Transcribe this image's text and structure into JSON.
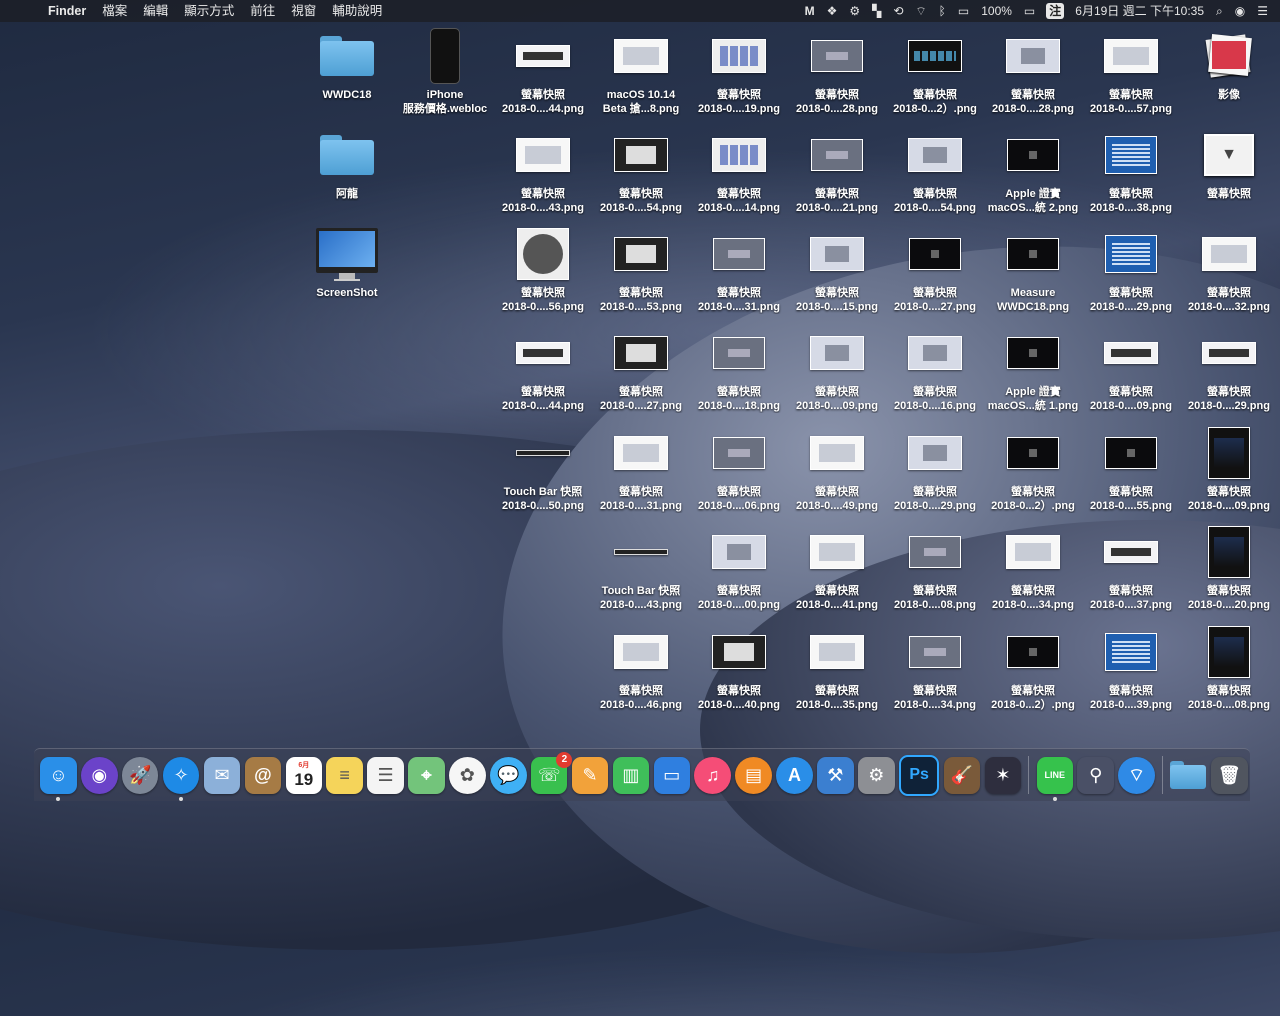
{
  "menubar": {
    "app": "Finder",
    "menus": [
      "檔案",
      "編輯",
      "顯示方式",
      "前往",
      "視窗",
      "輔助說明"
    ],
    "battery": "100%",
    "input_method": "注",
    "clock": "6月19日 週二 下午10:35"
  },
  "desktop": {
    "icons": [
      {
        "label": [
          "WWDC18",
          ""
        ],
        "kind": "folder"
      },
      {
        "label": [
          "iPhone",
          "服務價格.webloc"
        ],
        "kind": "phone"
      },
      {
        "label": [
          "螢幕快照",
          "2018-0....44.png"
        ],
        "kind": "bar"
      },
      {
        "label": [
          "macOS 10.14",
          "Beta 搶...8.png"
        ],
        "kind": "light"
      },
      {
        "label": [
          "螢幕快照",
          "2018-0....19.png"
        ],
        "kind": "grid"
      },
      {
        "label": [
          "螢幕快照",
          "2018-0....28.png"
        ],
        "kind": "gray"
      },
      {
        "label": [
          "螢幕快照",
          "2018-0...2）.png"
        ],
        "kind": "darkgrid"
      },
      {
        "label": [
          "螢幕快照",
          "2018-0....28.png"
        ],
        "kind": "dialog"
      },
      {
        "label": [
          "螢幕快照",
          "2018-0....57.png"
        ],
        "kind": "light"
      },
      {
        "label": [
          "影像",
          ""
        ],
        "kind": "stack"
      },
      {
        "label": [
          "阿龍",
          ""
        ],
        "kind": "folder"
      },
      {
        "label": [
          "螢幕快照",
          "2018-0....43.png"
        ],
        "kind": "light"
      },
      {
        "label": [
          "螢幕快照",
          "2018-0....54.png"
        ],
        "kind": "dark"
      },
      {
        "label": [
          "螢幕快照",
          "2018-0....14.png"
        ],
        "kind": "grid"
      },
      {
        "label": [
          "螢幕快照",
          "2018-0....21.png"
        ],
        "kind": "gray"
      },
      {
        "label": [
          "螢幕快照",
          "2018-0....54.png"
        ],
        "kind": "dialog"
      },
      {
        "label": [
          "Apple 證實",
          "macOS...統 2.png"
        ],
        "kind": "black"
      },
      {
        "label": [
          "螢幕快照",
          "2018-0....38.png"
        ],
        "kind": "blue"
      },
      {
        "label": [
          "螢幕快照",
          ""
        ],
        "kind": "download"
      },
      {
        "label": [
          "ScreenShot",
          ""
        ],
        "kind": "imac"
      },
      {
        "label": [
          "螢幕快照",
          "2018-0....56.png"
        ],
        "kind": "photo"
      },
      {
        "label": [
          "螢幕快照",
          "2018-0....53.png"
        ],
        "kind": "dark"
      },
      {
        "label": [
          "螢幕快照",
          "2018-0....31.png"
        ],
        "kind": "gray"
      },
      {
        "label": [
          "螢幕快照",
          "2018-0....15.png"
        ],
        "kind": "dialog"
      },
      {
        "label": [
          "螢幕快照",
          "2018-0....27.png"
        ],
        "kind": "black"
      },
      {
        "label": [
          "Measure",
          "WWDC18.png"
        ],
        "kind": "black"
      },
      {
        "label": [
          "螢幕快照",
          "2018-0....29.png"
        ],
        "kind": "blue"
      },
      {
        "label": [
          "螢幕快照",
          "2018-0....32.png"
        ],
        "kind": "light"
      },
      {
        "label": [
          "螢幕快照",
          "2018-0....44.png"
        ],
        "kind": "bar"
      },
      {
        "label": [
          "螢幕快照",
          "2018-0....27.png"
        ],
        "kind": "dark"
      },
      {
        "label": [
          "螢幕快照",
          "2018-0....18.png"
        ],
        "kind": "gray"
      },
      {
        "label": [
          "螢幕快照",
          "2018-0....09.png"
        ],
        "kind": "dialog"
      },
      {
        "label": [
          "螢幕快照",
          "2018-0....16.png"
        ],
        "kind": "dialog"
      },
      {
        "label": [
          "Apple 證實",
          "macOS...統 1.png"
        ],
        "kind": "black"
      },
      {
        "label": [
          "螢幕快照",
          "2018-0....09.png"
        ],
        "kind": "bar"
      },
      {
        "label": [
          "螢幕快照",
          "2018-0....29.png"
        ],
        "kind": "bar"
      },
      {
        "label": [
          "Touch Bar 快照",
          "2018-0....50.png"
        ],
        "kind": "strip"
      },
      {
        "label": [
          "螢幕快照",
          "2018-0....31.png"
        ],
        "kind": "light"
      },
      {
        "label": [
          "螢幕快照",
          "2018-0....06.png"
        ],
        "kind": "gray"
      },
      {
        "label": [
          "螢幕快照",
          "2018-0....49.png"
        ],
        "kind": "light"
      },
      {
        "label": [
          "螢幕快照",
          "2018-0....29.png"
        ],
        "kind": "dialog"
      },
      {
        "label": [
          "螢幕快照",
          "2018-0...2）.png"
        ],
        "kind": "black"
      },
      {
        "label": [
          "螢幕快照",
          "2018-0....55.png"
        ],
        "kind": "black"
      },
      {
        "label": [
          "螢幕快照",
          "2018-0....09.png"
        ],
        "kind": "tall"
      },
      {
        "label": [
          "Touch Bar 快照",
          "2018-0....43.png"
        ],
        "kind": "strip"
      },
      {
        "label": [
          "螢幕快照",
          "2018-0....00.png"
        ],
        "kind": "dialog"
      },
      {
        "label": [
          "螢幕快照",
          "2018-0....41.png"
        ],
        "kind": "light"
      },
      {
        "label": [
          "螢幕快照",
          "2018-0....08.png"
        ],
        "kind": "gray"
      },
      {
        "label": [
          "螢幕快照",
          "2018-0....34.png"
        ],
        "kind": "light"
      },
      {
        "label": [
          "螢幕快照",
          "2018-0....37.png"
        ],
        "kind": "bar"
      },
      {
        "label": [
          "螢幕快照",
          "2018-0....20.png"
        ],
        "kind": "tall"
      },
      {
        "label": [
          "螢幕快照",
          "2018-0....46.png"
        ],
        "kind": "light"
      },
      {
        "label": [
          "螢幕快照",
          "2018-0....40.png"
        ],
        "kind": "dark"
      },
      {
        "label": [
          "螢幕快照",
          "2018-0....35.png"
        ],
        "kind": "light"
      },
      {
        "label": [
          "螢幕快照",
          "2018-0....34.png"
        ],
        "kind": "gray"
      },
      {
        "label": [
          "螢幕快照",
          "2018-0...2）.png"
        ],
        "kind": "black"
      },
      {
        "label": [
          "螢幕快照",
          "2018-0....39.png"
        ],
        "kind": "blue"
      },
      {
        "label": [
          "螢幕快照",
          "2018-0....08.png"
        ],
        "kind": "tall"
      }
    ]
  },
  "dock": {
    "messages_badge": "2",
    "calendar_month": "6月",
    "calendar_day": "19",
    "photoshop_label": "Ps",
    "line_label": "LINE",
    "apps": [
      {
        "name": "finder-dock-icon",
        "color": "#2a8fe8",
        "glyph": "☺",
        "dot": true
      },
      {
        "name": "siri-dock-icon",
        "color": "#6b43c9",
        "glyph": "◉",
        "dot": false
      },
      {
        "name": "launchpad-dock-icon",
        "color": "#7d8797",
        "glyph": "🚀",
        "dot": false
      },
      {
        "name": "safari-dock-icon",
        "color": "#1e8ae6",
        "glyph": "✧",
        "dot": true
      },
      {
        "name": "mail-preview-dock-icon",
        "color": "#8cb0d9",
        "glyph": "✉",
        "dot": false
      },
      {
        "name": "contacts-dock-icon",
        "color": "#a67b45",
        "glyph": "@",
        "dot": false
      },
      {
        "name": "calendar-dock-icon",
        "color": "#ffffff",
        "glyph": "",
        "dot": false
      },
      {
        "name": "notes-dock-icon",
        "color": "#f5d45a",
        "glyph": "≡",
        "dot": false
      },
      {
        "name": "reminders-dock-icon",
        "color": "#f4f4f4",
        "glyph": "☰",
        "dot": false
      },
      {
        "name": "maps-dock-icon",
        "color": "#73c47b",
        "glyph": "⌖",
        "dot": false
      },
      {
        "name": "photos-dock-icon",
        "color": "#f6f6f6",
        "glyph": "✿",
        "dot": false
      },
      {
        "name": "messages-dock-icon",
        "color": "#3fb0f5",
        "glyph": "💬",
        "dot": false
      },
      {
        "name": "facetime-dock-icon",
        "color": "#39c04e",
        "glyph": "☏",
        "dot": false
      },
      {
        "name": "pages-dock-icon",
        "color": "#f2a23a",
        "glyph": "✎",
        "dot": false
      },
      {
        "name": "numbers-dock-icon",
        "color": "#3fbf5a",
        "glyph": "▥",
        "dot": false
      },
      {
        "name": "keynote-dock-icon",
        "color": "#2f7fe0",
        "glyph": "▭",
        "dot": false
      },
      {
        "name": "itunes-dock-icon",
        "color": "#f54d77",
        "glyph": "♫",
        "dot": false
      },
      {
        "name": "ibooks-dock-icon",
        "color": "#f08a24",
        "glyph": "▤",
        "dot": false
      },
      {
        "name": "app-store-dock-icon",
        "color": "#2a8ee8",
        "glyph": "A",
        "dot": false
      },
      {
        "name": "xcode-dock-icon",
        "color": "#3b7fd0",
        "glyph": "⚒",
        "dot": false
      },
      {
        "name": "system-preferences-dock-icon",
        "color": "#8d8f94",
        "glyph": "⚙",
        "dot": false
      },
      {
        "name": "photoshop-dock-icon",
        "color": "#0f2238",
        "glyph": "",
        "dot": false
      },
      {
        "name": "instruments-dock-icon",
        "color": "#7a5a3a",
        "glyph": "🎸",
        "dot": false
      },
      {
        "name": "final-cut-dock-icon",
        "color": "#2e2e3e",
        "glyph": "✶",
        "dot": false
      },
      {
        "name": "sep",
        "color": "",
        "glyph": "",
        "dot": false
      },
      {
        "name": "line-dock-icon",
        "color": "#36c24c",
        "glyph": "",
        "dot": true
      },
      {
        "name": "network-tool-dock-icon",
        "color": "#4a5066",
        "glyph": "⚲",
        "dot": false
      },
      {
        "name": "wifi-tool-dock-icon",
        "color": "#2f8ae6",
        "glyph": "⌔",
        "dot": false
      },
      {
        "name": "sep",
        "color": "",
        "glyph": "",
        "dot": false
      },
      {
        "name": "downloads-folder-dock-icon",
        "color": "#5aa5d6",
        "glyph": "",
        "dot": false
      },
      {
        "name": "trash-dock-icon",
        "color": "#50555f",
        "glyph": "🗑",
        "dot": false
      }
    ]
  }
}
